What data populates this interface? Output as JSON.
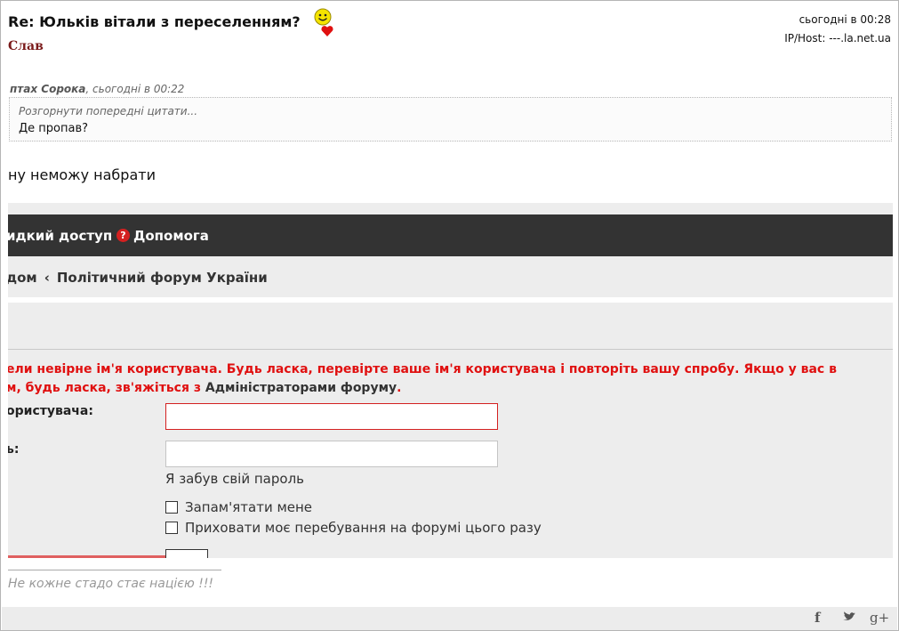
{
  "post": {
    "title": "Re: Юльків вітали з  переселенням?",
    "author": "Слав",
    "date": "сьогодні в 00:28",
    "iphost": "IP/Host: ---.la.net.ua",
    "body": "ну неможу набрати",
    "signature": "Не кожне стадо стає нацією !!!"
  },
  "quote": {
    "author": "птах Сорока",
    "date": ", сьогодні в 00:22",
    "expand": "Розгорнути попередні цитати...",
    "text": "Де пропав?"
  },
  "screenshot": {
    "nav_quick": "идкий доступ",
    "help_glyph": "?",
    "nav_help": "Допомога",
    "crumb_home": "дом",
    "crumb_sep": "‹",
    "crumb_forum": "Політичний форум України",
    "error_line1": "ели невірне ім'я користувача. Будь ласка, перевірте ваше ім'я користувача і повторіть вашу спробу. Якщо у вас в",
    "error_line2_a": "м, будь ласка, зв'яжіться з ",
    "error_admin": "Адміністраторами форуму",
    "error_line2_b": ".",
    "label_username": "ористувача:",
    "label_password": "ь:",
    "forgot": "Я забув свій пароль",
    "remember": "Запам'ятати мене",
    "hide": "Приховати моє перебування на форумі цього разу"
  },
  "share": {
    "facebook_glyph": "f",
    "twitter_glyph": "🐦",
    "gplus_glyph": "g+"
  },
  "icons": {
    "smiley": "smiley-icon",
    "heart": "heart-icon",
    "help": "help-icon",
    "facebook": "facebook-icon",
    "twitter": "twitter-icon",
    "gplus": "google-plus-icon"
  },
  "colors": {
    "author": "#7a1a1a",
    "error": "#e01010",
    "navbar": "#333333",
    "heart": "#e01010",
    "smiley": "#f5e400"
  }
}
